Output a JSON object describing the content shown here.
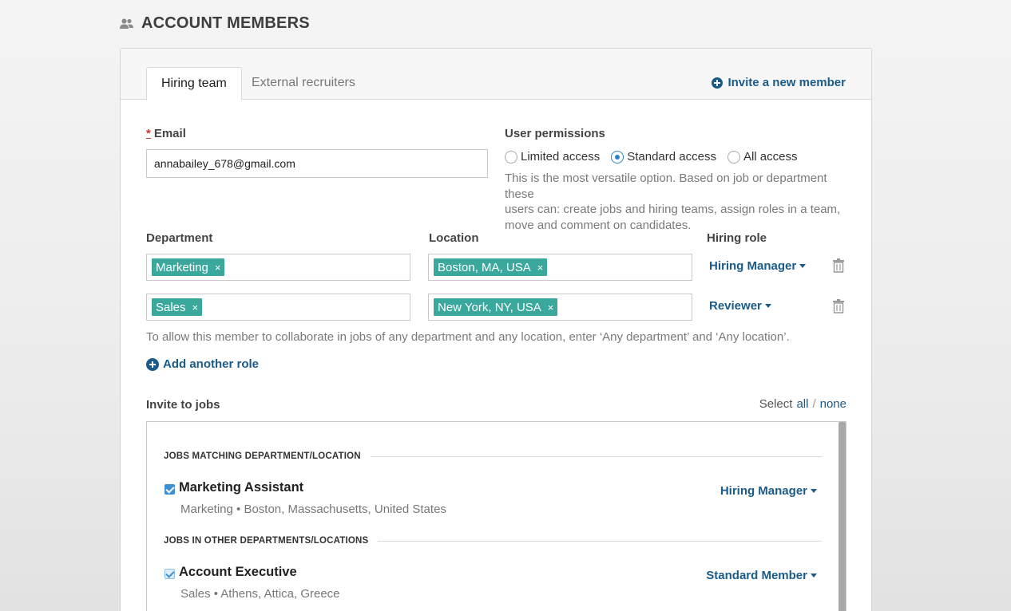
{
  "header": {
    "title": "ACCOUNT MEMBERS",
    "icon": "people-icon"
  },
  "tabs": [
    {
      "label": "Hiring team",
      "active": true
    },
    {
      "label": "External recruiters",
      "active": false
    }
  ],
  "invite_link": "Invite a new member",
  "email": {
    "label": "Email",
    "required_mark": "*",
    "value": "annabailey_678@gmail.com"
  },
  "permissions": {
    "label": "User permissions",
    "options": [
      {
        "label": "Limited access",
        "selected": false
      },
      {
        "label": "Standard access",
        "selected": true
      },
      {
        "label": "All access",
        "selected": false
      }
    ],
    "help_lines": [
      "This is the most versatile option. Based on job or department these",
      "users can: create jobs and hiring teams, assign roles in a team,",
      "move and comment on candidates."
    ]
  },
  "roles": {
    "department_label": "Department",
    "location_label": "Location",
    "hiring_role_label": "Hiring role",
    "rows": [
      {
        "department": "Marketing",
        "location": "Boston, MA, USA",
        "role": "Hiring Manager"
      },
      {
        "department": "Sales",
        "location": "New York, NY, USA",
        "role": "Reviewer"
      }
    ],
    "tag_remove": "×",
    "hint": "To allow this member to collaborate in jobs of any department and any location, enter ‘Any department’ and ‘Any location’.",
    "add_role": "Add another role"
  },
  "invite_jobs": {
    "label": "Invite to jobs",
    "select_prefix": "Select",
    "select_all": "all",
    "separator": "/",
    "select_none": "none",
    "sections": [
      {
        "heading": "JOBS MATCHING DEPARTMENT/LOCATION",
        "jobs": [
          {
            "title": "Marketing Assistant",
            "meta": "Marketing • Boston, Massachusetts, United States",
            "role": "Hiring Manager",
            "checked": true
          }
        ]
      },
      {
        "heading": "JOBS IN OTHER DEPARTMENTS/LOCATIONS",
        "jobs": [
          {
            "title": "Account Executive",
            "meta": "Sales • Athens, Attica, Greece",
            "role": "Standard Member",
            "checked": true
          }
        ]
      }
    ]
  },
  "colors": {
    "link": "#1a5b8a",
    "tag": "#3aa89d",
    "checkbox": "#3d8fd4"
  }
}
